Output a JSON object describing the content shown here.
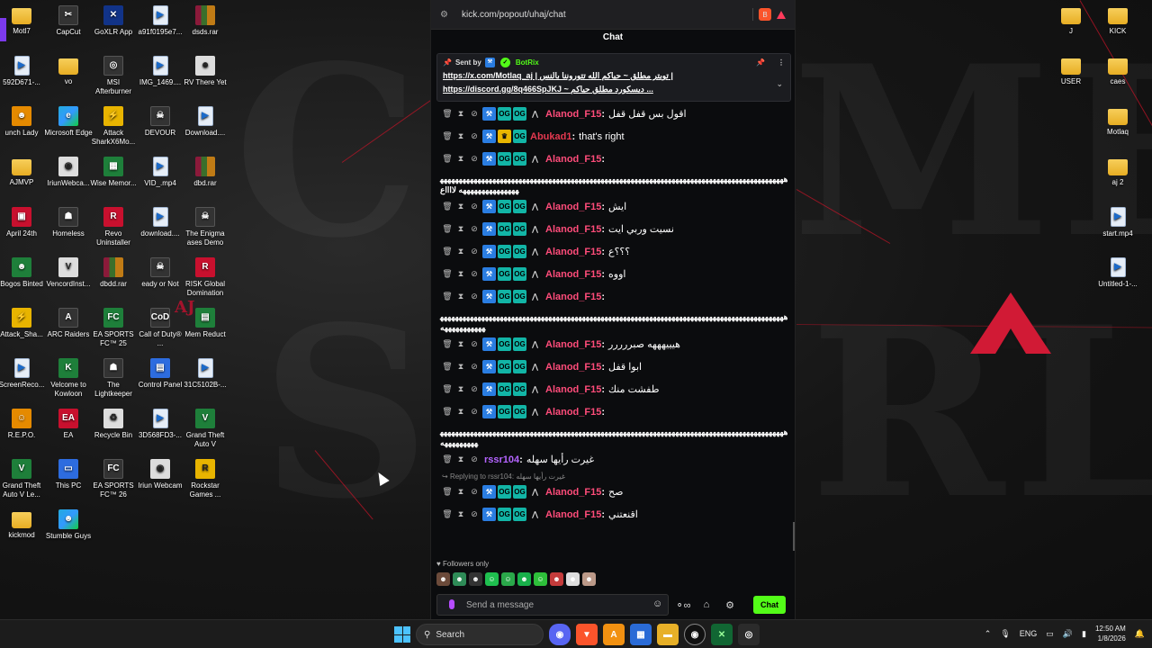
{
  "desktop": {
    "icons": [
      {
        "label": "Motl7",
        "kind": "folder",
        "glyph": ""
      },
      {
        "label": "CapCut",
        "kind": "dark",
        "glyph": "✂"
      },
      {
        "label": "GoXLR App",
        "kind": "teal",
        "glyph": "✕"
      },
      {
        "label": "a91f0195e7...",
        "kind": "file",
        "glyph": "▶"
      },
      {
        "label": "dsds.rar",
        "kind": "rar",
        "glyph": ""
      },
      {
        "label": "592D671-...",
        "kind": "file",
        "glyph": "▶"
      },
      {
        "label": "vo",
        "kind": "folder",
        "glyph": ""
      },
      {
        "label": "MSI Afterburner",
        "kind": "dark",
        "glyph": "◎"
      },
      {
        "label": "IMG_1469....",
        "kind": "file",
        "glyph": "▶"
      },
      {
        "label": "RV There Yet",
        "kind": "white",
        "glyph": "☻"
      },
      {
        "label": "unch Lady",
        "kind": "orange",
        "glyph": "☻"
      },
      {
        "label": "Microsoft Edge",
        "kind": "grad",
        "glyph": "e"
      },
      {
        "label": "Attack SharkX6Mo...",
        "kind": "yellow",
        "glyph": "⚡"
      },
      {
        "label": "DEVOUR",
        "kind": "dark",
        "glyph": "☠"
      },
      {
        "label": "Download....",
        "kind": "file",
        "glyph": "▶"
      },
      {
        "label": "AJMVP",
        "kind": "folder",
        "glyph": ""
      },
      {
        "label": "IriunWebca...",
        "kind": "white",
        "glyph": "◉"
      },
      {
        "label": "Wise Memor...",
        "kind": "green",
        "glyph": "▦"
      },
      {
        "label": "VID_.mp4",
        "kind": "file",
        "glyph": "▶"
      },
      {
        "label": "dbd.rar",
        "kind": "rar",
        "glyph": ""
      },
      {
        "label": "April 24th",
        "kind": "red",
        "glyph": "▣"
      },
      {
        "label": "Homeless",
        "kind": "dark",
        "glyph": "☗"
      },
      {
        "label": "Revo Uninstaller",
        "kind": "red",
        "glyph": "R"
      },
      {
        "label": "download....",
        "kind": "file",
        "glyph": "▶"
      },
      {
        "label": "The Enigma ases Demo",
        "kind": "dark",
        "glyph": "☠"
      },
      {
        "label": "Bogos Binted",
        "kind": "green",
        "glyph": "☻"
      },
      {
        "label": "VencordInst...",
        "kind": "white",
        "glyph": "V"
      },
      {
        "label": "dbdd.rar",
        "kind": "rar",
        "glyph": ""
      },
      {
        "label": "eady or Not",
        "kind": "dark",
        "glyph": "☠"
      },
      {
        "label": "RISK Global Domination",
        "kind": "red",
        "glyph": "R"
      },
      {
        "label": "Attack_Sha...",
        "kind": "yellow",
        "glyph": "⚡"
      },
      {
        "label": "ARC Raiders",
        "kind": "dark",
        "glyph": "A"
      },
      {
        "label": "EA SPORTS FC™ 25",
        "kind": "green",
        "glyph": "FC"
      },
      {
        "label": "Call of Duty® ...",
        "kind": "dark",
        "glyph": "CoD"
      },
      {
        "label": "Mem Reduct",
        "kind": "green",
        "glyph": "▤"
      },
      {
        "label": "ScreenReco...",
        "kind": "file",
        "glyph": "▶"
      },
      {
        "label": "Velcome to Kowloon",
        "kind": "green",
        "glyph": "K"
      },
      {
        "label": "The Lightkeeper",
        "kind": "dark",
        "glyph": "☗"
      },
      {
        "label": "Control Panel",
        "kind": "app",
        "glyph": "▤"
      },
      {
        "label": "31C5102B-...",
        "kind": "file",
        "glyph": "▶"
      },
      {
        "label": "R.E.P.O.",
        "kind": "orange",
        "glyph": "☺"
      },
      {
        "label": "EA",
        "kind": "red",
        "glyph": "EA"
      },
      {
        "label": "Recycle Bin",
        "kind": "white",
        "glyph": "♻"
      },
      {
        "label": "3D568FD3-...",
        "kind": "file",
        "glyph": "▶"
      },
      {
        "label": "Grand Theft Auto V",
        "kind": "green",
        "glyph": "V"
      },
      {
        "label": "Grand Theft Auto V Le...",
        "kind": "green",
        "glyph": "V"
      },
      {
        "label": "This PC",
        "kind": "app",
        "glyph": "▭"
      },
      {
        "label": "EA SPORTS FC™ 26",
        "kind": "dark",
        "glyph": "FC"
      },
      {
        "label": "Iriun Webcam",
        "kind": "white",
        "glyph": "◉"
      },
      {
        "label": "Rockstar Games ...",
        "kind": "yellow",
        "glyph": "R"
      },
      {
        "label": "kickmod",
        "kind": "folder",
        "glyph": ""
      },
      {
        "label": "Stumble Guys",
        "kind": "grad",
        "glyph": "☻"
      }
    ],
    "right_icons": [
      {
        "label": "J",
        "kind": "folder"
      },
      {
        "label": "KICK",
        "kind": "folder"
      },
      {
        "label": "USER",
        "kind": "folder"
      },
      {
        "label": "caes",
        "kind": "folder"
      },
      {
        "label": "Motlaq",
        "kind": "folder"
      },
      {
        "label": "aj 2",
        "kind": "folder"
      },
      {
        "label": "start.mp4",
        "kind": "file"
      },
      {
        "label": "Untitled-1-...",
        "kind": "file"
      }
    ],
    "aj_sign": "AJ"
  },
  "browser": {
    "url": "kick.com/popout/uhaj/chat",
    "title": "Chat"
  },
  "pinned": {
    "sent_by_label": "Sent by",
    "bot_name": "BotRix",
    "line1": "https://x.com/Motlaq_aj | تويتر مطلق ~ حياكم الله تتوروننا بالنس |",
    "line2": "https://discord.gg/8q466SpJKJ ~ ديسكورد مطلق حياكم ..."
  },
  "messages": [
    {
      "type": "msg",
      "user": "Alanod_F15",
      "ucls": "u-alanod",
      "badges": [
        "mod",
        "og",
        "og"
      ],
      "crown": false,
      "sub": true,
      "text": "اقول بس قفل قفل"
    },
    {
      "type": "msg",
      "user": "Abukad1",
      "ucls": "u-abukad",
      "badges": [
        "mod",
        "crown",
        "og"
      ],
      "crown": true,
      "sub": false,
      "text": "that's right"
    },
    {
      "type": "msg",
      "user": "Alanod_F15",
      "ucls": "u-alanod",
      "badges": [
        "mod",
        "og",
        "og"
      ],
      "sub": true,
      "text": ""
    },
    {
      "type": "spam",
      "text": "ههههههههههههههههههههههههههههههههههههههههههههههههههههههههههههههههههههههههههههههههههههههههههههههههههههههههههههه لااااع"
    },
    {
      "type": "msg",
      "user": "Alanod_F15",
      "ucls": "u-alanod",
      "badges": [
        "mod",
        "og",
        "og"
      ],
      "sub": true,
      "text": "ايش"
    },
    {
      "type": "msg",
      "user": "Alanod_F15",
      "ucls": "u-alanod",
      "badges": [
        "mod",
        "og",
        "og"
      ],
      "sub": true,
      "text": "نسيت وربي ايت"
    },
    {
      "type": "msg",
      "user": "Alanod_F15",
      "ucls": "u-alanod",
      "badges": [
        "mod",
        "og",
        "og"
      ],
      "sub": true,
      "text": "؟؟؟ع"
    },
    {
      "type": "msg",
      "user": "Alanod_F15",
      "ucls": "u-alanod",
      "badges": [
        "mod",
        "og",
        "og"
      ],
      "sub": true,
      "text": "اووه"
    },
    {
      "type": "msg",
      "user": "Alanod_F15",
      "ucls": "u-alanod",
      "badges": [
        "mod",
        "og",
        "og"
      ],
      "sub": true,
      "text": ""
    },
    {
      "type": "spam",
      "text": "ههههههههههههههههههههههههههههههههههههههههههههههههههههههههههههههههههههههههههههههههههههههههههههههههههههههههه"
    },
    {
      "type": "msg",
      "user": "Alanod_F15",
      "ucls": "u-alanod",
      "badges": [
        "mod",
        "og",
        "og"
      ],
      "sub": true,
      "text": "هيييهههه صبررررر"
    },
    {
      "type": "msg",
      "user": "Alanod_F15",
      "ucls": "u-alanod",
      "badges": [
        "mod",
        "og",
        "og"
      ],
      "sub": true,
      "text": "ابوا قفل"
    },
    {
      "type": "msg",
      "user": "Alanod_F15",
      "ucls": "u-alanod",
      "badges": [
        "mod",
        "og",
        "og"
      ],
      "sub": true,
      "text": "طفشت منك"
    },
    {
      "type": "msg",
      "user": "Alanod_F15",
      "ucls": "u-alanod",
      "badges": [
        "mod",
        "og",
        "og"
      ],
      "sub": true,
      "text": ""
    },
    {
      "type": "spam",
      "text": "ههههههههههههههههههههههههههههههههههههههههههههههههههههههههههههههههههههههههههههههههههههههههههههههههههههههه"
    },
    {
      "type": "msg",
      "user": "rssr104",
      "ucls": "u-rssr",
      "badges": [],
      "sub": false,
      "text": "غيرت رأيها سهله"
    },
    {
      "type": "reply",
      "text": "Replying to rssr104: غيرت رأيها سهله"
    },
    {
      "type": "msg",
      "user": "Alanod_F15",
      "ucls": "u-alanod",
      "badges": [
        "mod",
        "og",
        "og"
      ],
      "sub": true,
      "text": "صح"
    },
    {
      "type": "msg",
      "user": "Alanod_F15",
      "ucls": "u-alanod",
      "badges": [
        "mod",
        "og",
        "og"
      ],
      "sub": true,
      "text": "اقنعتني"
    }
  ],
  "footer": {
    "followers_only": "Followers only",
    "input_placeholder": "Send a message",
    "chat_button": "Chat"
  },
  "taskbar": {
    "search_label": "Search",
    "language": "ENG",
    "time": "12:50 AM",
    "date": "1/8/2026"
  },
  "colors": {
    "kick_green": "#53fc18",
    "alanod": "#ff4c7a",
    "abukad": "#e53950",
    "rssr": "#b464ff"
  }
}
